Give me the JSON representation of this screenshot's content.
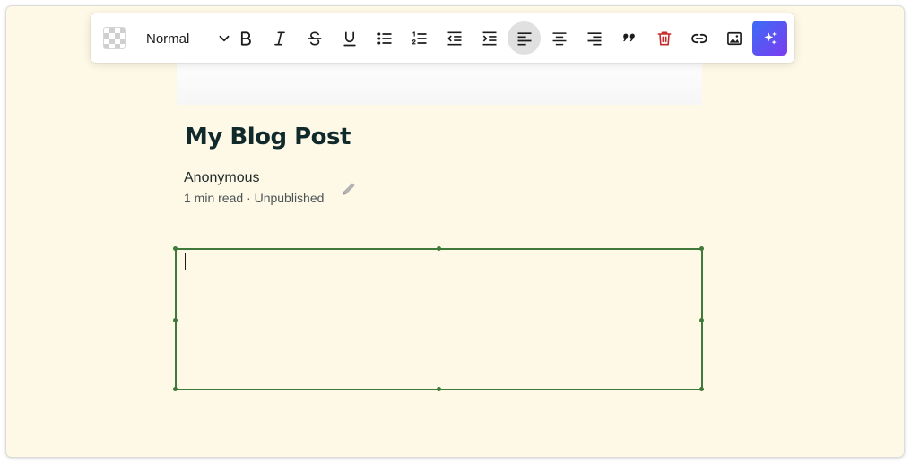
{
  "toolbar": {
    "text_style": "Normal",
    "buttons": [
      {
        "name": "bold",
        "icon": "bold-icon"
      },
      {
        "name": "italic",
        "icon": "italic-icon"
      },
      {
        "name": "strikethrough",
        "icon": "strikethrough-icon"
      },
      {
        "name": "underline",
        "icon": "underline-icon"
      },
      {
        "name": "bullet-list",
        "icon": "bullet-list-icon"
      },
      {
        "name": "numbered-list",
        "icon": "numbered-list-icon"
      },
      {
        "name": "outdent",
        "icon": "outdent-icon"
      },
      {
        "name": "indent",
        "icon": "indent-icon"
      },
      {
        "name": "align-left",
        "icon": "align-left-icon",
        "active": true
      },
      {
        "name": "align-center",
        "icon": "align-center-icon"
      },
      {
        "name": "align-right",
        "icon": "align-right-icon"
      },
      {
        "name": "quote",
        "icon": "quote-icon"
      },
      {
        "name": "delete",
        "icon": "trash-icon"
      },
      {
        "name": "link",
        "icon": "link-icon"
      },
      {
        "name": "image",
        "icon": "image-icon"
      },
      {
        "name": "ai-assist",
        "icon": "sparkles-icon"
      }
    ]
  },
  "post": {
    "title": "My Blog Post",
    "author": "Anonymous",
    "meta": "1 min read · Unpublished"
  },
  "colors": {
    "page_background": "#fef8e6",
    "title": "#10292b",
    "editor_border": "#3f7a3a",
    "delete_icon": "#c62828",
    "ai_gradient_start": "#3b6cf6",
    "ai_gradient_end": "#7a3cf0",
    "active_button": "#e0e0e0"
  }
}
